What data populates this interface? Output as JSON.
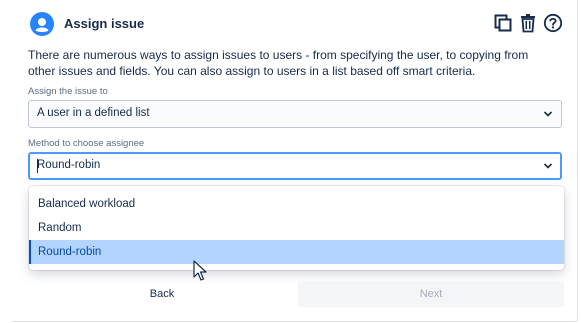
{
  "header": {
    "title": "Assign issue",
    "icons": [
      "user-avatar-icon",
      "copy-icon",
      "trash-icon",
      "help-icon"
    ]
  },
  "description": "There are numerous ways to assign issues to users - from specifying the user, to copying from other issues and fields. You can also assign to users in a list based off smart criteria.",
  "assign_field": {
    "label": "Assign the issue to",
    "value": "A user in a defined list"
  },
  "method_field": {
    "label": "Method to choose assignee",
    "value": "Round-robin",
    "options": [
      "Balanced workload",
      "Random",
      "Round-robin"
    ],
    "selected": "Round-robin"
  },
  "buttons": {
    "back": "Back",
    "next": "Next"
  },
  "colors": {
    "accent": "#2684ff",
    "focus_border": "#4c9aff",
    "selected_bg": "#b3d4ff",
    "text": "#172b4d"
  }
}
